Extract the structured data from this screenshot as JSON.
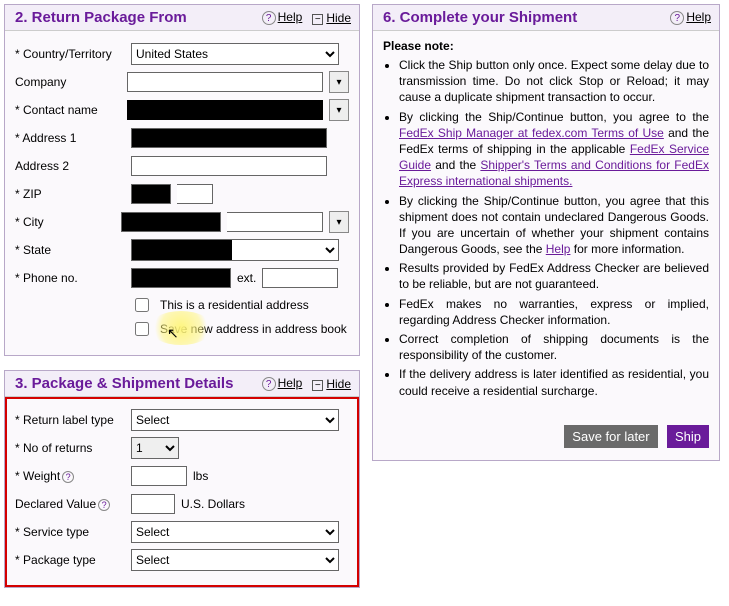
{
  "section2": {
    "title": "2. Return Package From",
    "help": "Help",
    "hide": "Hide",
    "fields": {
      "country_label": "Country/Territory",
      "country_value": "United States",
      "company_label": "Company",
      "contact_label": "Contact name",
      "address1_label": "Address 1",
      "address2_label": "Address 2",
      "zip_label": "ZIP",
      "city_label": "City",
      "state_label": "State",
      "phone_label": "Phone no.",
      "ext_label": "ext."
    },
    "check_residential": "This is a residential address",
    "check_save": "Save new address in address book"
  },
  "section3": {
    "title": "3. Package & Shipment Details",
    "help": "Help",
    "hide": "Hide",
    "fields": {
      "return_label_type": "Return label type",
      "return_label_value": "Select",
      "no_returns": "No of returns",
      "no_returns_value": "1",
      "weight": "Weight",
      "weight_unit": "lbs",
      "declared": "Declared Value",
      "declared_unit": "U.S. Dollars",
      "service_type": "Service type",
      "service_value": "Select",
      "package_type": "Package type",
      "package_value": "Select"
    }
  },
  "section6": {
    "title": "6. Complete your Shipment",
    "help": "Help",
    "note": "Please note:",
    "b1": "Click the Ship button only once. Expect some delay due to transmission time. Do not click Stop or Reload; it may cause a duplicate shipment transaction to occur.",
    "b2a": "By clicking the Ship/Continue button, you agree to the ",
    "b2link1": "FedEx Ship Manager at fedex.com Terms of Use",
    "b2b": " and the FedEx terms of shipping in the applicable ",
    "b2link2": "FedEx Service Guide",
    "b2c": " and the ",
    "b2link3": "Shipper's Terms and Conditions for FedEx Express international shipments.",
    "b3a": "By clicking the Ship/Continue button, you agree that this shipment does not contain undeclared Dangerous Goods. If you are uncertain of whether your shipment contains Dangerous Goods, see the ",
    "b3link": "Help",
    "b3b": " for more information.",
    "b4": "Results provided by FedEx Address Checker are believed to be reliable, but are not guaranteed.",
    "b5": "FedEx makes no warranties, express or implied, regarding Address Checker information.",
    "b6": "Correct completion of shipping documents is the responsibility of the customer.",
    "b7": "If the delivery address is later identified as residential, you could receive a residential surcharge.",
    "save_later": "Save for later",
    "ship": "Ship"
  }
}
